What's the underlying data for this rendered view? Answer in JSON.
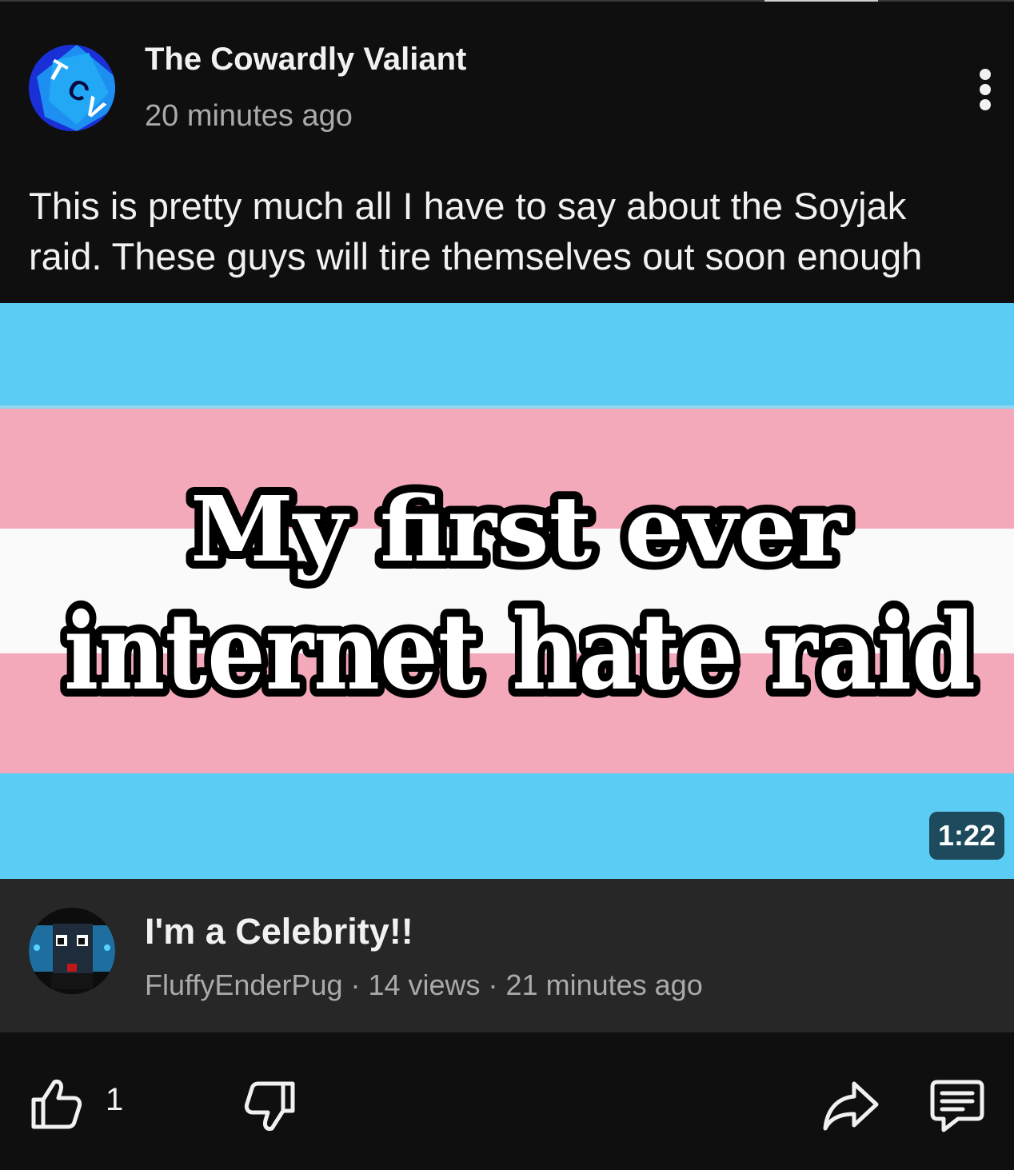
{
  "post": {
    "channel_name": "The Cowardly Valiant",
    "time": "20 minutes ago",
    "text": "This is pretty much all I have to say about the Soyjak raid. These guys will tire themselves out soon enough",
    "avatar_letters": "TCV"
  },
  "thumbnail": {
    "line1": "My first ever",
    "line2": "internet hate raid",
    "duration": "1:22",
    "colors": {
      "blue": "#5bcdf5",
      "pink": "#f3a9ba",
      "white": "#fafafa"
    }
  },
  "video": {
    "title": "I'm a Celebrity!!",
    "channel": "FluffyEnderPug",
    "views": "14 views",
    "time": "21 minutes ago",
    "separator": " · "
  },
  "actions": {
    "like_count": "1",
    "icons": [
      "thumbs-up-icon",
      "thumbs-down-icon",
      "share-icon",
      "comment-icon"
    ]
  }
}
